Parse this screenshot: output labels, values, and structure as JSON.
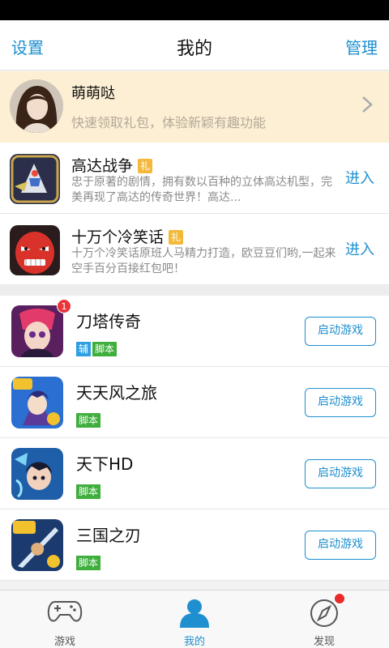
{
  "nav": {
    "left": "设置",
    "title": "我的",
    "right": "管理"
  },
  "profile": {
    "name": "萌萌哒",
    "subtitle": "快速领取礼包，体验新颖有趣功能"
  },
  "promos": [
    {
      "title": "高达战争",
      "gift": "礼",
      "desc": "忠于原著的剧情，拥有数以百种的立体高达机型，完美再现了高达的传奇世界！高达...",
      "action": "进入"
    },
    {
      "title": "十万个冷笑话",
      "gift": "礼",
      "desc": "十万个冷笑话原班人马精力打造，欧豆豆们哟,一起来空手百分百接红包吧！",
      "action": "进入"
    }
  ],
  "games": [
    {
      "name": "刀塔传奇",
      "badge": "1",
      "tags": [
        "辅",
        "脚本"
      ],
      "action": "启动游戏"
    },
    {
      "name": "天天风之旅",
      "tags": [
        "脚本"
      ],
      "action": "启动游戏"
    },
    {
      "name": "天下HD",
      "tags": [
        "脚本"
      ],
      "action": "启动游戏"
    },
    {
      "name": "三国之刃",
      "tags": [
        "脚本"
      ],
      "action": "启动游戏"
    }
  ],
  "tabs": [
    {
      "label": "游戏"
    },
    {
      "label": "我的"
    },
    {
      "label": "发现"
    }
  ],
  "colors": {
    "accent": "#1e8fcf",
    "profile_bg": "#fcefd3",
    "badge": "#e9343a"
  }
}
